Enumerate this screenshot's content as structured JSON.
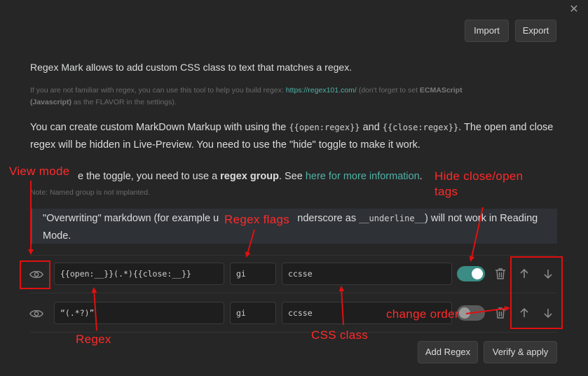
{
  "header": {
    "close_glyph": "✕",
    "import_label": "Import",
    "export_label": "Export"
  },
  "content": {
    "intro": "Regex Mark allows to add custom CSS class to text that matches a regex.",
    "note1_pre": "If you are not familiar with regex, you can use this tool to help you build regex: ",
    "note1_link": "https://regex101.com/",
    "note1_mid": " (don't forget to set ",
    "note1_bold1": "ECMAScript",
    "note1_bold2": "(Javascript)",
    "note1_post": " as the FLAVOR in the settings).",
    "p2_a": "You can create custom MarkDown Markup with using the ",
    "p2_code1": "{{open:regex}}",
    "p2_b": " and ",
    "p2_code2": "{{close:regex}}",
    "p2_c": ". The open and close regex will be hidden in Live-Preview. You need to use the \"hide\" toggle to make it work.",
    "p3_a": "e the toggle, you need to use a ",
    "p3_bold": "regex group",
    "p3_b": ". See ",
    "p3_link": "here for more information",
    "p3_c": ".",
    "note2": "Note: Named group is not implanted.",
    "callout_a": "\"Overwriting\" markdown (for example u",
    "callout_b": "nderscore as ",
    "callout_code": "__underline__",
    "callout_c": ") will not work in Reading Mode."
  },
  "rows": [
    {
      "regex": "{{open:__}}(.*){{close:__}}",
      "flags": "gi",
      "css_class": "ccsse",
      "hide_toggle": "on"
    },
    {
      "regex": "“(.*?)”",
      "flags": "gi",
      "css_class": "ccsse",
      "hide_toggle": "off"
    }
  ],
  "footer": {
    "add_label": "Add Regex",
    "verify_label": "Verify & apply"
  },
  "annotations": {
    "view_mode": "View mode",
    "regex_flags": "Regex flags",
    "hide_close_open_1": "Hide close/open",
    "hide_close_open_2": "tags",
    "regex": "Regex",
    "css_class": "CSS class",
    "change_order": "change order",
    "color": "#ff2a2a"
  },
  "colors": {
    "background": "#262626",
    "accent": "#3a8c84",
    "link": "#4fb3a8",
    "annotation": "#ff2a2a"
  }
}
